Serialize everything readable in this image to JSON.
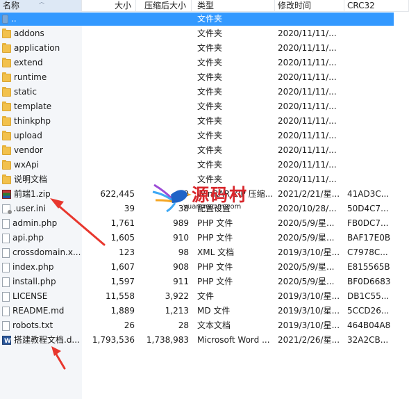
{
  "header": {
    "name": "名称",
    "size": "大小",
    "packed": "压缩后大小",
    "type": "类型",
    "modified": "修改时间",
    "crc": "CRC32"
  },
  "files": [
    {
      "name": "..",
      "icon": "parent-folder-icon",
      "size": "",
      "packed": "",
      "type": "文件夹",
      "modified": "",
      "crc": "",
      "selected": true
    },
    {
      "name": "addons",
      "icon": "folder-icon",
      "size": "",
      "packed": "",
      "type": "文件夹",
      "modified": "2020/11/11/...",
      "crc": ""
    },
    {
      "name": "application",
      "icon": "folder-icon",
      "size": "",
      "packed": "",
      "type": "文件夹",
      "modified": "2020/11/11/...",
      "crc": ""
    },
    {
      "name": "extend",
      "icon": "folder-icon",
      "size": "",
      "packed": "",
      "type": "文件夹",
      "modified": "2020/11/11/...",
      "crc": ""
    },
    {
      "name": "runtime",
      "icon": "folder-icon",
      "size": "",
      "packed": "",
      "type": "文件夹",
      "modified": "2020/11/11/...",
      "crc": ""
    },
    {
      "name": "static",
      "icon": "folder-icon",
      "size": "",
      "packed": "",
      "type": "文件夹",
      "modified": "2020/11/11/...",
      "crc": ""
    },
    {
      "name": "template",
      "icon": "folder-icon",
      "size": "",
      "packed": "",
      "type": "文件夹",
      "modified": "2020/11/11/...",
      "crc": ""
    },
    {
      "name": "thinkphp",
      "icon": "folder-icon",
      "size": "",
      "packed": "",
      "type": "文件夹",
      "modified": "2020/11/11/...",
      "crc": ""
    },
    {
      "name": "upload",
      "icon": "folder-icon",
      "size": "",
      "packed": "",
      "type": "文件夹",
      "modified": "2020/11/11/...",
      "crc": ""
    },
    {
      "name": "vendor",
      "icon": "folder-icon",
      "size": "",
      "packed": "",
      "type": "文件夹",
      "modified": "2020/11/11/...",
      "crc": ""
    },
    {
      "name": "wxApi",
      "icon": "folder-icon",
      "size": "",
      "packed": "",
      "type": "文件夹",
      "modified": "2020/11/11/...",
      "crc": ""
    },
    {
      "name": "说明文档",
      "icon": "folder-icon",
      "size": "",
      "packed": "",
      "type": "文件夹",
      "modified": "2020/11/11/...",
      "crc": ""
    },
    {
      "name": "前端1.zip",
      "icon": "zip-archive-icon",
      "size": "622,445",
      "packed": "9",
      "type": "WinRAR ZIP 压缩...",
      "modified": "2021/2/21/星...",
      "crc": "41AD3C..."
    },
    {
      "name": ".user.ini",
      "icon": "ini-settings-icon",
      "size": "39",
      "packed": "38",
      "type": "配置设置",
      "modified": "2020/10/28/...",
      "crc": "50D4C7..."
    },
    {
      "name": "admin.php",
      "icon": "document-icon",
      "size": "1,761",
      "packed": "989",
      "type": "PHP 文件",
      "modified": "2020/5/9/星...",
      "crc": "FB0DC7..."
    },
    {
      "name": "api.php",
      "icon": "document-icon",
      "size": "1,605",
      "packed": "910",
      "type": "PHP 文件",
      "modified": "2020/5/9/星...",
      "crc": "BAF17E0B"
    },
    {
      "name": "crossdomain.x...",
      "icon": "document-icon",
      "size": "123",
      "packed": "98",
      "type": "XML 文档",
      "modified": "2019/3/10/星...",
      "crc": "C7978C..."
    },
    {
      "name": "index.php",
      "icon": "document-icon",
      "size": "1,607",
      "packed": "908",
      "type": "PHP 文件",
      "modified": "2020/5/9/星...",
      "crc": "E815565B"
    },
    {
      "name": "install.php",
      "icon": "document-icon",
      "size": "1,597",
      "packed": "911",
      "type": "PHP 文件",
      "modified": "2020/5/9/星...",
      "crc": "BF0D6683"
    },
    {
      "name": "LICENSE",
      "icon": "document-icon",
      "size": "11,558",
      "packed": "3,922",
      "type": "文件",
      "modified": "2019/3/10/星...",
      "crc": "DB1C55..."
    },
    {
      "name": "README.md",
      "icon": "document-icon",
      "size": "1,889",
      "packed": "1,213",
      "type": "MD 文件",
      "modified": "2019/3/10/星...",
      "crc": "5CCD26..."
    },
    {
      "name": "robots.txt",
      "icon": "document-icon",
      "size": "26",
      "packed": "28",
      "type": "文本文档",
      "modified": "2019/3/10/星...",
      "crc": "464B04A8"
    },
    {
      "name": "搭建教程文档.d...",
      "icon": "word-document-icon",
      "size": "1,793,536",
      "packed": "1,738,983",
      "type": "Microsoft Word ...",
      "modified": "2021/2/26/星...",
      "crc": "32A2CB..."
    }
  ],
  "watermark": {
    "text": "源码村",
    "url": "yuanmacun.com"
  },
  "colors": {
    "selection": "#3399ff",
    "arrow": "#e8372e",
    "watermark": "#d8262b"
  }
}
